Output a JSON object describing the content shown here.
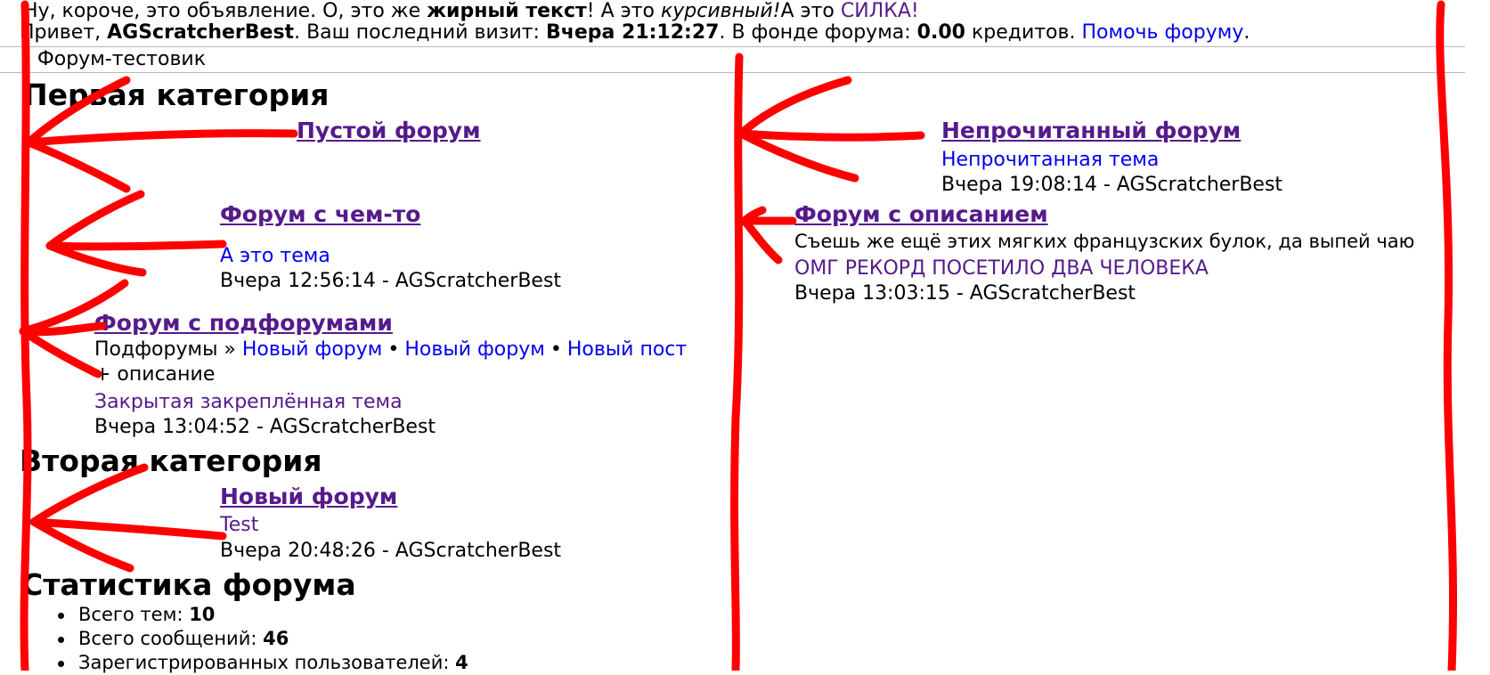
{
  "announcement": {
    "prefix": "Ну, короче, это объявление. О, это же ",
    "bold": "жирный текст",
    "mid": "! А это ",
    "italic": "курсивный!",
    "after_italic": "А это ",
    "link": "СИЛКА!"
  },
  "welcome": {
    "greeting": "Привет, ",
    "username": "AGScratcherBest",
    "last_visit_label": ". Ваш последний визит: ",
    "last_visit": "Вчера 21:12:27",
    "fund_label": ". В фонде форума: ",
    "fund": "0.00",
    "credits_label": " кредитов. ",
    "help_link": "Помочь форуму",
    "end": "."
  },
  "breadcrumb": {
    "separator": "›",
    "label": "Форум-тестовик"
  },
  "categories": [
    {
      "title": "Первая категория",
      "forums": [
        {
          "name": "Пустой форум"
        },
        {
          "name": "Непрочитанный форум",
          "topic": "Непрочитанная тема",
          "last_post": "Вчера 19:08:14 - AGScratcherBest"
        },
        {
          "name": "Форум с чем-то",
          "topic": "А это тема",
          "last_post": "Вчера 12:56:14 - AGScratcherBest"
        },
        {
          "name": "Форум с описанием",
          "description": "Съешь же ещё этих мягких французских булок, да выпей чаю",
          "topic": "ОМГ РЕКОРД ПОСЕТИЛО ДВА ЧЕЛОВЕКА",
          "last_post": "Вчера 13:03:15 - AGScratcherBest"
        },
        {
          "name": "Форум с подфорумами",
          "subforums_label": "Подфорумы »",
          "subforums": [
            "Новый форум",
            "Новый форум",
            "Новый пост"
          ],
          "description": "+ описание",
          "topic": "Закрытая закреплённая тема",
          "last_post": "Вчера 13:04:52 - AGScratcherBest"
        }
      ]
    },
    {
      "title": "Вторая категория",
      "forums": [
        {
          "name": "Новый форум",
          "topic": "Test",
          "last_post": "Вчера 20:48:26 - AGScratcherBest"
        }
      ]
    }
  ],
  "stats": {
    "title": "Статистика форума",
    "items": [
      {
        "label": "Всего тем: ",
        "value": "10"
      },
      {
        "label": "Всего сообщений: ",
        "value": "46"
      },
      {
        "label": "Зарегистрированных пользователей: ",
        "value": "4"
      }
    ]
  },
  "colors": {
    "annotation": "#ff0000",
    "visited_link": "#551a8b",
    "link": "#0000ee"
  }
}
